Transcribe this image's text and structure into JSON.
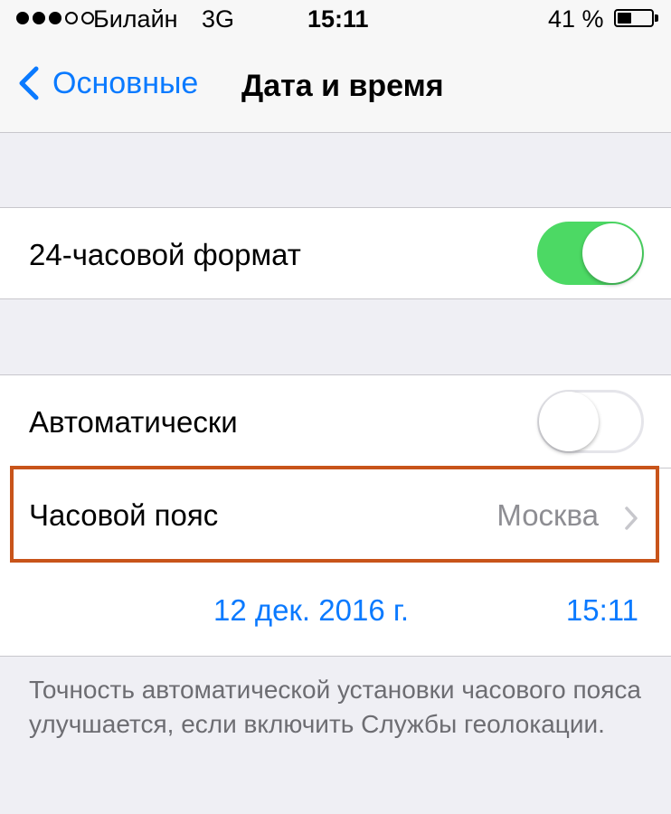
{
  "status_bar": {
    "carrier": "Билайн",
    "network": "3G",
    "time": "15:11",
    "battery_percent": "41 %",
    "battery_level": 0.41,
    "signal_bars_filled": 3,
    "signal_bars_total": 5
  },
  "nav": {
    "back_label": "Основные",
    "title": "Дата и время"
  },
  "settings": {
    "format_24h": {
      "label": "24-часовой формат",
      "enabled": true
    },
    "automatic": {
      "label": "Автоматически",
      "enabled": false
    },
    "timezone": {
      "label": "Часовой пояс",
      "value": "Москва"
    },
    "date": "12 дек. 2016 г.",
    "time": "15:11"
  },
  "footer_note": "Точность автоматической установки часового пояса улучшается, если включить Службы геолокации.",
  "colors": {
    "accent": "#0a7aff",
    "toggle_on": "#4cd964",
    "highlight": "#c8541a"
  }
}
